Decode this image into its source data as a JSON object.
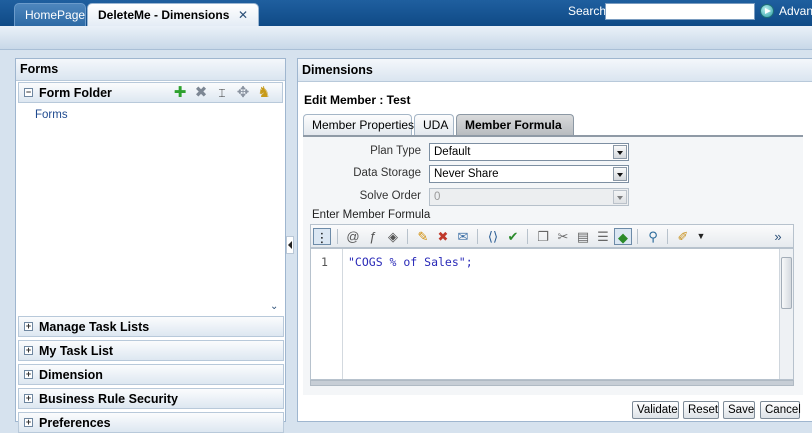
{
  "topbar": {
    "tabs": [
      {
        "label": "HomePage"
      },
      {
        "label": "DeleteMe - Dimensions",
        "close": "✕"
      }
    ],
    "search_label": "Search",
    "search_value": "",
    "advanced_label": "Advanc"
  },
  "left_panel": {
    "title": "Forms",
    "folder": {
      "title": "Form Folder",
      "toggle": "−",
      "items": [
        "Forms"
      ]
    },
    "accordions": [
      {
        "label": "Manage Task Lists",
        "toggle": "+"
      },
      {
        "label": "My Task List",
        "toggle": "+"
      },
      {
        "label": "Dimension",
        "toggle": "+"
      },
      {
        "label": "Business Rule Security",
        "toggle": "+"
      },
      {
        "label": "Preferences",
        "toggle": "+"
      }
    ],
    "scroll_chevron": "⌄"
  },
  "right_panel": {
    "title": "Dimensions",
    "edit_title": "Edit Member : Test",
    "tabs": [
      {
        "label": "Member Properties"
      },
      {
        "label": "UDA"
      },
      {
        "label": "Member Formula",
        "active": true
      }
    ],
    "fields": {
      "plan_type": {
        "label": "Plan Type",
        "value": "Default"
      },
      "data_storage": {
        "label": "Data Storage",
        "value": "Never Share"
      },
      "solve_order": {
        "label": "Solve Order",
        "value": "0"
      }
    },
    "enter_formula_label": "Enter Member Formula",
    "editor": {
      "line_number": "1",
      "code": "\"COGS % of Sales\";"
    },
    "toolbar_more": "»",
    "buttons": {
      "validate": "Validate",
      "reset": "Reset",
      "save": "Save",
      "cancel": "Cancel"
    }
  },
  "colors": {
    "topbar": "#0f4a86",
    "code_text": "#2a2ab8",
    "link": "#1f4a8f"
  }
}
